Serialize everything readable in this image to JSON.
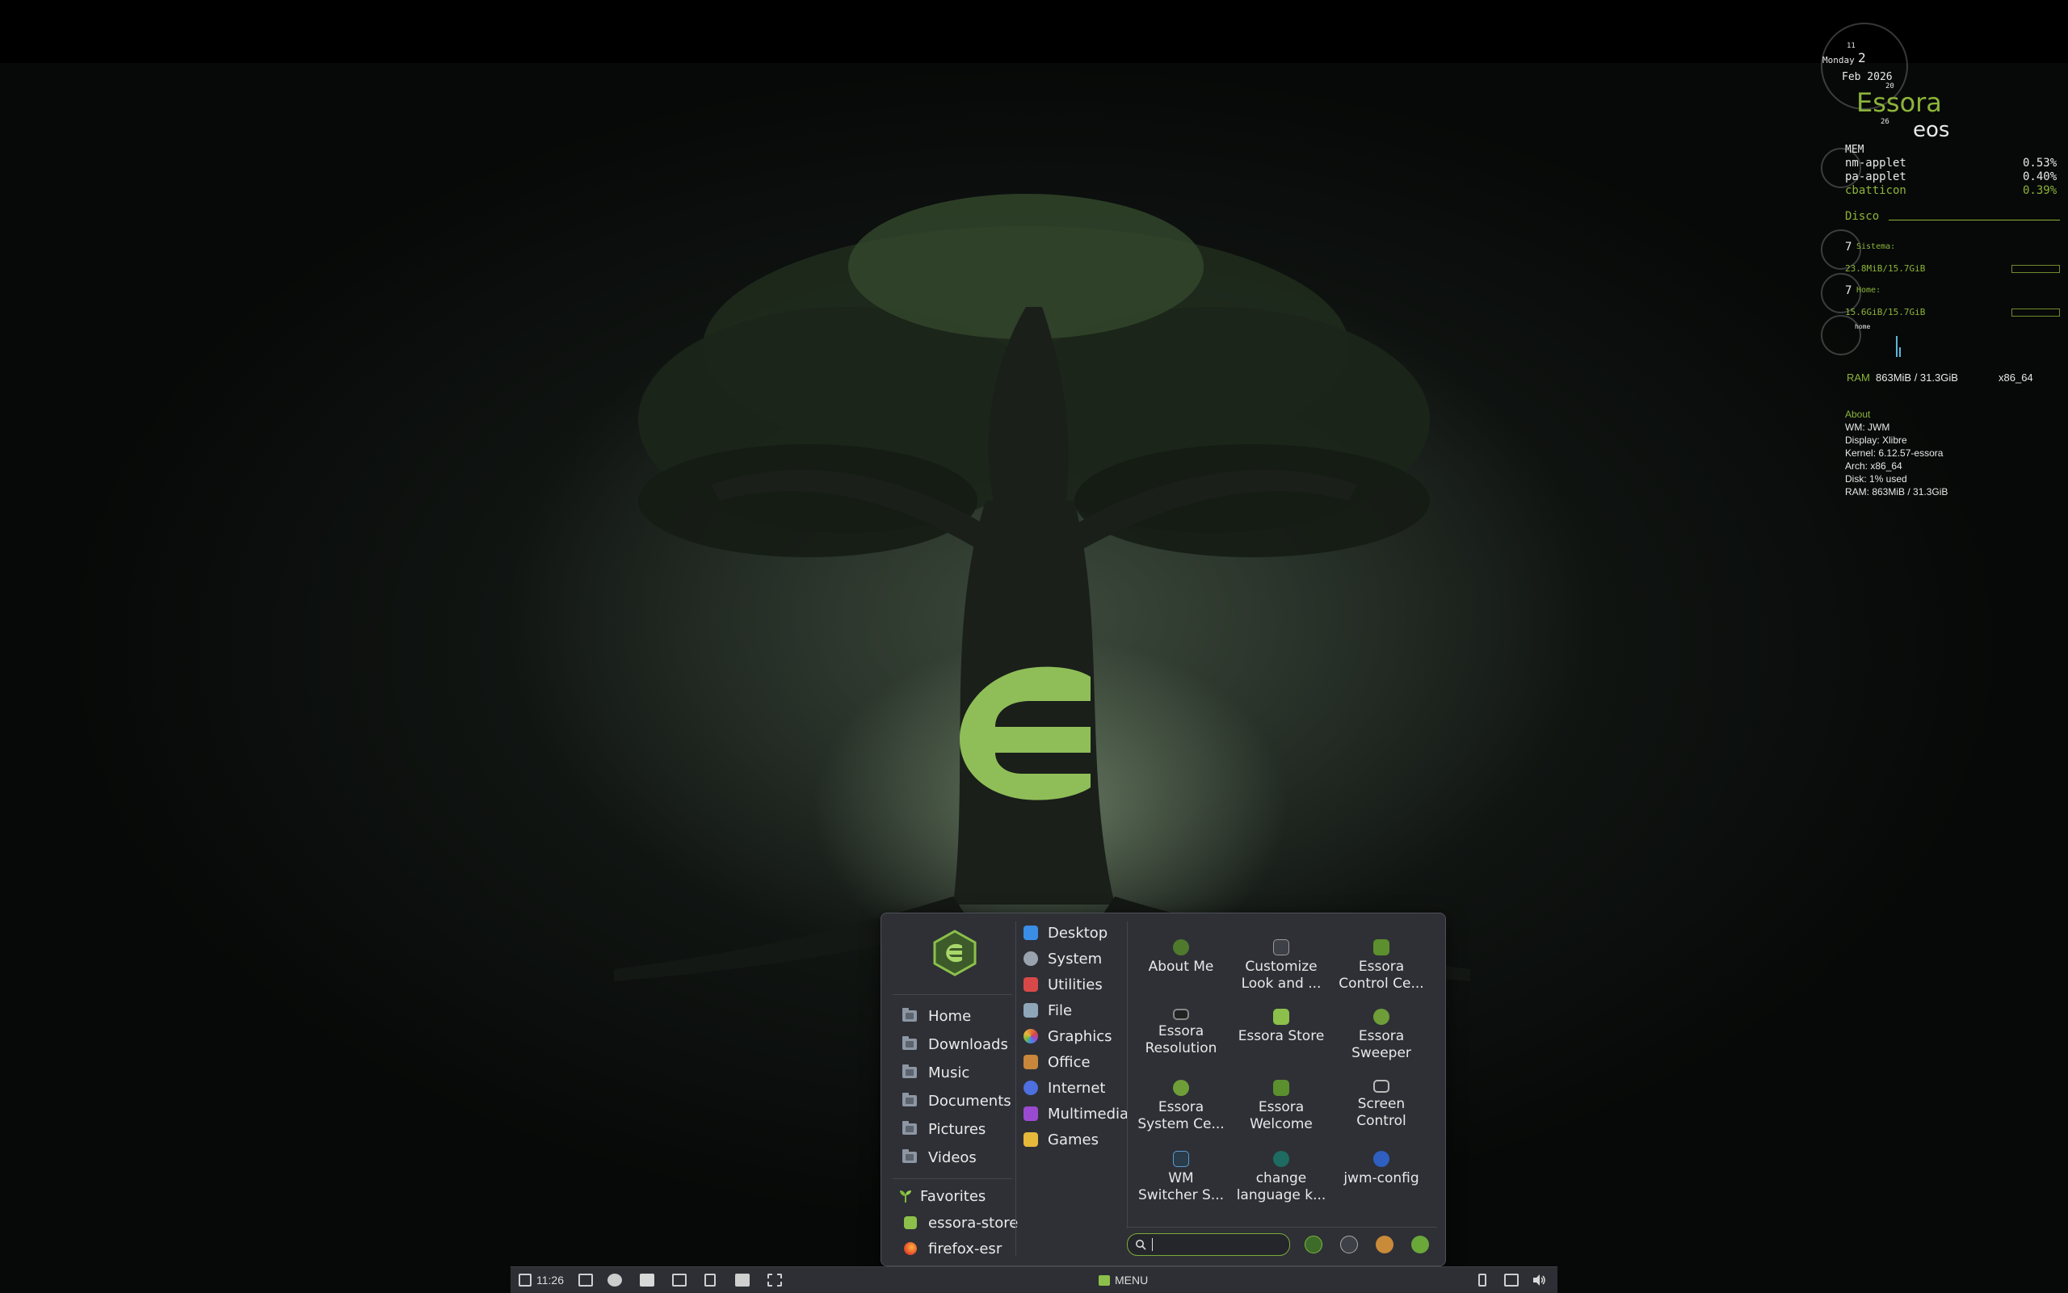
{
  "conky": {
    "day": "Monday",
    "day_num": "2",
    "month_year": "Feb 2026",
    "clock_marks": [
      "11",
      "20",
      "26"
    ],
    "brand": "Essora",
    "host": "eos",
    "mem_title": "MEM",
    "processes": [
      {
        "name": "nm-applet",
        "value": "0.53%"
      },
      {
        "name": "pa-applet",
        "value": "0.40%"
      },
      {
        "name": "cbatticon",
        "value": "0.39%"
      }
    ],
    "disk_title": "Disco",
    "sistema_num": "7",
    "sistema_label": "Sistema:",
    "sistema_value": "23.8MiB/15.7GiB",
    "home_num": "7",
    "home_label": "Home:",
    "home_value": "15.6GiB/15.7GiB",
    "home_small": "home",
    "ram_label": "RAM",
    "ram_value": "863MiB / 31.3GiB",
    "arch": "x86_64",
    "about_title": "About",
    "about_lines": [
      "WM: JWM",
      "Display: Xlibre",
      "Kernel: 6.12.57-essora",
      "Arch: x86_64",
      "Disk: 1% used",
      "RAM: 863MiB / 31.3GiB"
    ]
  },
  "menu": {
    "places": [
      "Home",
      "Downloads",
      "Music",
      "Documents",
      "Pictures",
      "Videos"
    ],
    "categories": [
      {
        "label": "Desktop",
        "color": "#3a8ee6"
      },
      {
        "label": "System",
        "color": "#9aa3ad"
      },
      {
        "label": "Utilities",
        "color": "#d94848"
      },
      {
        "label": "File",
        "color": "#8fa6b8"
      },
      {
        "label": "Graphics",
        "color": "#e0803c"
      },
      {
        "label": "Office",
        "color": "#c8873a"
      },
      {
        "label": "Internet",
        "color": "#4d6fe0"
      },
      {
        "label": "Multimedia",
        "color": "#9a4ad0"
      },
      {
        "label": "Games",
        "color": "#e6b93a"
      }
    ],
    "apps": [
      {
        "line1": "About Me",
        "line2": ""
      },
      {
        "line1": "Customize",
        "line2": "Look and ..."
      },
      {
        "line1": "Essora",
        "line2": "Control Ce..."
      },
      {
        "line1": "Essora",
        "line2": "Resolution"
      },
      {
        "line1": "Essora Store",
        "line2": ""
      },
      {
        "line1": "Essora",
        "line2": "Sweeper"
      },
      {
        "line1": "Essora",
        "line2": "System Ce..."
      },
      {
        "line1": "Essora",
        "line2": "Welcome"
      },
      {
        "line1": "Screen",
        "line2": "Control"
      },
      {
        "line1": "WM",
        "line2": "Switcher S..."
      },
      {
        "line1": "change",
        "line2": "language k..."
      },
      {
        "line1": "jwm-config",
        "line2": ""
      }
    ],
    "favorites_label": "Favorites",
    "favorites": [
      "essora-store",
      "firefox-esr"
    ],
    "search_placeholder": ""
  },
  "taskbar": {
    "time": "11:26",
    "menu_label": "MENU"
  }
}
